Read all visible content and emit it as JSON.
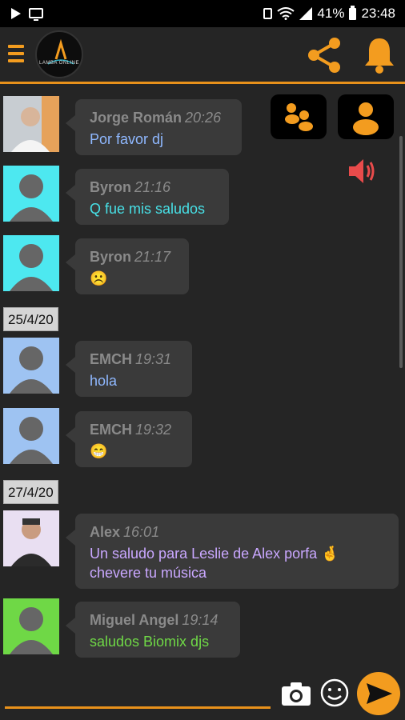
{
  "status_bar": {
    "battery": "41%",
    "time": "23:48"
  },
  "toolbar": {
    "logo_text": "LAMBA ONLINE",
    "menu_icon": "hamburger-icon",
    "share_icon": "share-icon",
    "bell_icon": "bell-icon",
    "accent_color": "#f39c1f"
  },
  "actions": {
    "group_icon": "users-icon",
    "user_icon": "user-icon",
    "volume_icon": "volume-icon"
  },
  "messages": [
    {
      "name": "Jorge Román",
      "time": "20:26",
      "text": "Por favor dj",
      "text_color": "#8fb8ff",
      "avatar": "photo"
    },
    {
      "name": "Byron",
      "time": "21:16",
      "text": "Q fue mis saludos",
      "text_color": "#47e0e6",
      "avatar": "cyan"
    },
    {
      "name": "Byron",
      "time": "21:17",
      "text": "☹️",
      "text_color": "#47e0e6",
      "avatar": "cyan"
    },
    {
      "name": "EMCH",
      "time": "19:31",
      "text": "hola",
      "text_color": "#8fb8ff",
      "avatar": "lightblue"
    },
    {
      "name": "EMCH",
      "time": "19:32",
      "text": "😁",
      "text_color": "#8fb8ff",
      "avatar": "lightblue"
    },
    {
      "name": "Alex",
      "time": "16:01",
      "text": "Un saludo para Leslie de Alex porfa 🤞 chevere tu música",
      "text_color": "#c9a7ff",
      "avatar": "photo"
    },
    {
      "name": "Miguel Angel",
      "time": "19:14",
      "text": "saludos Biomix djs",
      "text_color": "#6fd846",
      "avatar": "green"
    }
  ],
  "dates": [
    "25/4/20",
    "27/4/20"
  ],
  "input_bar": {
    "camera_icon": "camera-icon",
    "emoji_icon": "emoji-icon",
    "send_icon": "send-icon"
  }
}
